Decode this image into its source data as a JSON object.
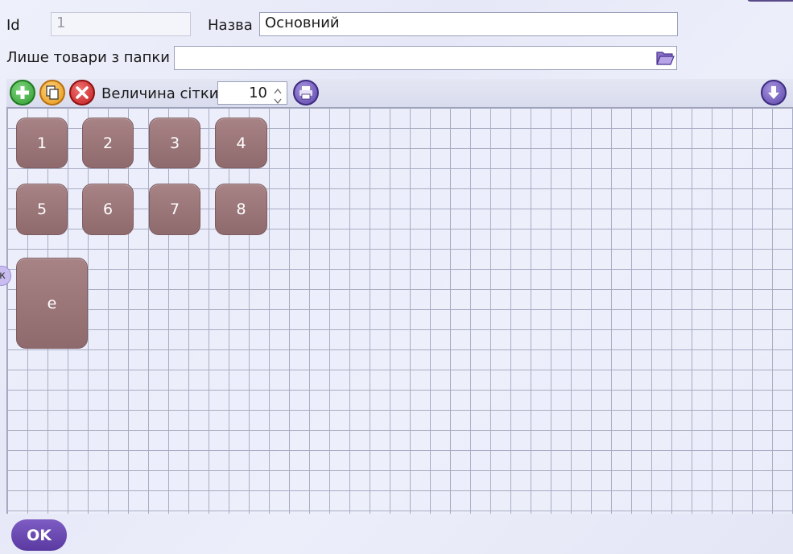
{
  "form": {
    "id_label": "Id",
    "id_value": "1",
    "name_label": "Назва",
    "name_value": "Основний",
    "folder_label": "Лише товари з папки",
    "folder_value": ""
  },
  "toolbar": {
    "grid_size_label": "Величина сітки",
    "grid_size_value": "10",
    "icons": [
      "add-icon",
      "copy-icon",
      "delete-icon",
      "print-icon",
      "download-icon"
    ]
  },
  "tiles": [
    "1",
    "2",
    "3",
    "4",
    "5",
    "6",
    "7",
    "8",
    "e"
  ],
  "side_tab_label": "к",
  "ok_label": "OK",
  "colors": {
    "tile": "#9a7679",
    "accent": "#6a48b0",
    "add": "#3cae3c",
    "copy": "#f0a020",
    "delete": "#d23030"
  }
}
